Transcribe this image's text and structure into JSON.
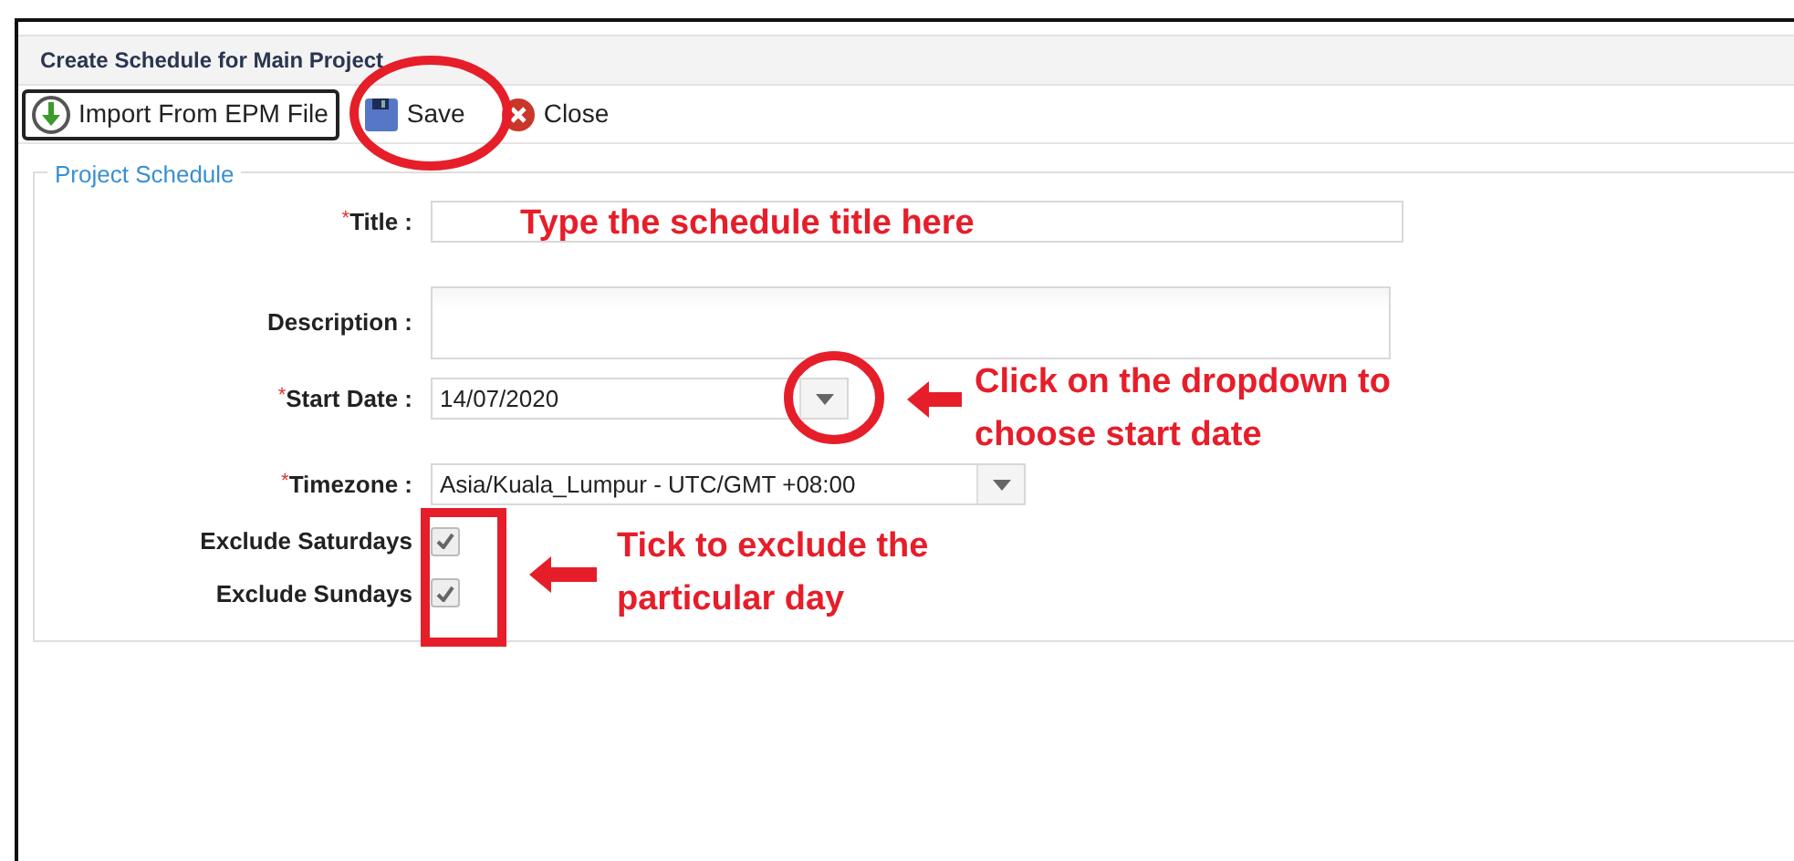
{
  "window": {
    "title": "Create Schedule for Main Project"
  },
  "toolbar": [
    {
      "kind": "import",
      "label": "Import From EPM File",
      "focused": true
    },
    {
      "kind": "save",
      "label": "Save",
      "focused": false
    },
    {
      "kind": "close",
      "label": "Close",
      "focused": false
    }
  ],
  "fieldset": {
    "legend": "Project Schedule",
    "fields": [
      {
        "kind": "text",
        "label": "Title :",
        "required_mark": "*"
      },
      {
        "kind": "textarea",
        "label": "Description :"
      },
      {
        "kind": "dropdown",
        "label": "Start Date :",
        "required_mark": "*",
        "value": "14/07/2020"
      },
      {
        "kind": "dropdown",
        "label": "Timezone :",
        "required_mark": "*",
        "value": "Asia/Kuala_Lumpur - UTC/GMT +08:00"
      },
      {
        "kind": "checkbox",
        "label": "Exclude Saturdays",
        "checked": true
      },
      {
        "kind": "checkbox",
        "label": "Exclude Sundays",
        "checked": true
      }
    ]
  },
  "annotations": [
    {
      "text": "Type the schedule title here"
    },
    {
      "text": "Click on the dropdown to choose start date"
    },
    {
      "text": "Tick to exclude the particular day"
    }
  ]
}
